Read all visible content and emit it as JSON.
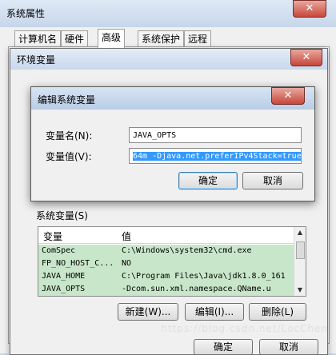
{
  "system_properties": {
    "title": "系统属性",
    "tabs": [
      "计算机名",
      "硬件",
      "高级",
      "系统保护",
      "远程"
    ],
    "active_tab": "高级",
    "buttons": {
      "ok": "确定",
      "cancel": "取消"
    }
  },
  "env_window": {
    "title": "环境变量",
    "system_vars_label": "系统变量(S)",
    "columns": {
      "name": "变量",
      "value": "值"
    },
    "rows": [
      {
        "name": "ComSpec",
        "value": "C:\\Windows\\system32\\cmd.exe"
      },
      {
        "name": "FP_NO_HOST_C...",
        "value": "NO"
      },
      {
        "name": "JAVA_HOME",
        "value": "C:\\Program Files\\Java\\jdk1.8.0_161"
      },
      {
        "name": "JAVA_OPTS",
        "value": "-Dcom.sun.xml.namespace.QName.u"
      }
    ],
    "buttons": {
      "new": "新建(W)...",
      "edit": "编辑(I)...",
      "delete": "删除(L)"
    }
  },
  "edit_dialog": {
    "title": "编辑系统变量",
    "name_label": "变量名(N):",
    "value_label": "变量值(V):",
    "name_value": "JAVA_OPTS",
    "value_value": "64m -Djava.net.preferIPv4Stack=true",
    "ok": "确定",
    "cancel": "取消"
  },
  "watermark": "https://blog.csdn.net/LocChen"
}
